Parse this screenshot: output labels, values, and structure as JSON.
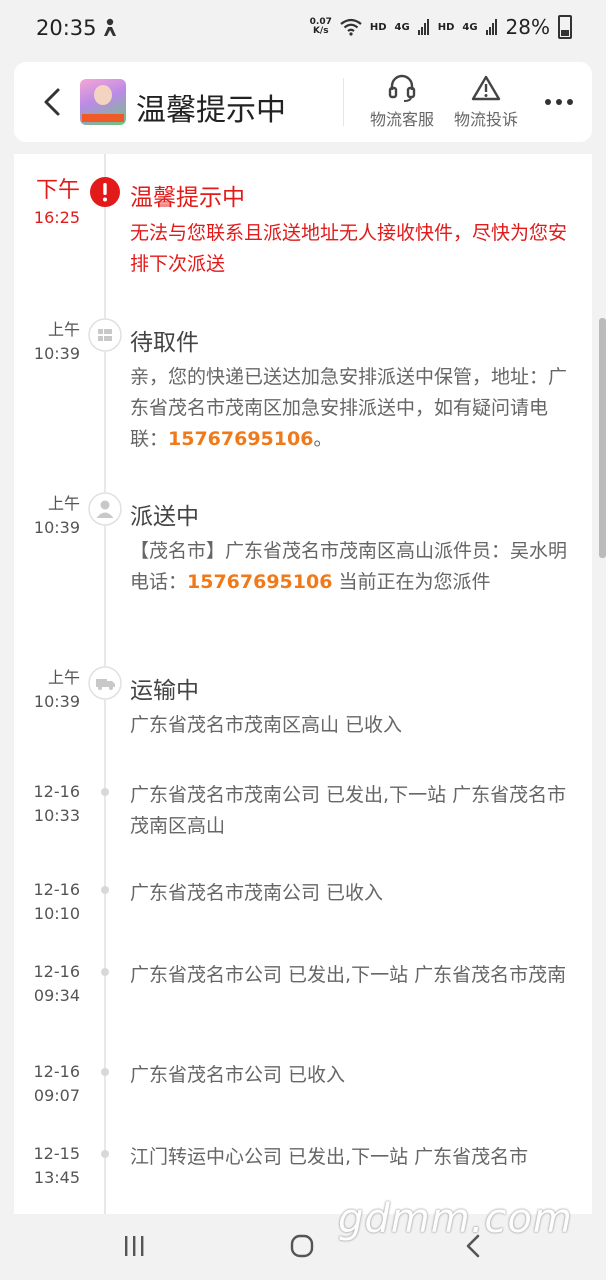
{
  "status_bar": {
    "time": "20:35",
    "speed_value": "0.07",
    "speed_unit": "K/s",
    "hd1": "HD",
    "net1": "4G",
    "hd2": "HD",
    "net2": "4G",
    "battery": "28%"
  },
  "header": {
    "title": "温馨提示中",
    "service_label": "物流客服",
    "complaint_label": "物流投诉",
    "icons": [
      "back-arrow-icon",
      "headset-icon",
      "warning-icon",
      "more-icon"
    ]
  },
  "timeline": [
    {
      "time1": "下午",
      "time2": "16:25",
      "title": "温馨提示中",
      "text": "无法与您联系且派送地址无人接收快件，尽快为您安排下次派送",
      "status": "alert"
    },
    {
      "time1": "上午",
      "time2": "10:39",
      "title": "待取件",
      "text_before": "亲，您的快递已送达加急安排派送中保管，地址：广东省茂名市茂南区加急安排派送中，如有疑问请电联：",
      "phone": "15767695106",
      "text_after": "。"
    },
    {
      "time1": "上午",
      "time2": "10:39",
      "title": "派送中",
      "text_before": "【茂名市】广东省茂名市茂南区高山派件员：吴水明 电话：",
      "phone": "15767695106",
      "text_after": " 当前正在为您派件"
    },
    {
      "time1": "上午",
      "time2": "10:39",
      "title": "运输中",
      "text": "广东省茂名市茂南区高山 已收入"
    },
    {
      "time1": "12-16",
      "time2": "10:33",
      "text": "广东省茂名市茂南公司 已发出,下一站 广东省茂名市茂南区高山"
    },
    {
      "time1": "12-16",
      "time2": "10:10",
      "text": "广东省茂名市茂南公司 已收入"
    },
    {
      "time1": "12-16",
      "time2": "09:34",
      "text": "广东省茂名市公司 已发出,下一站 广东省茂名市茂南"
    },
    {
      "time1": "12-16",
      "time2": "09:07",
      "text": "广东省茂名市公司 已收入"
    },
    {
      "time1": "12-15",
      "time2": "13:45",
      "text": "江门转运中心公司 已发出,下一站 广东省茂名市"
    }
  ],
  "watermark": "gdmm.com",
  "colors": {
    "alert": "#e21a1a",
    "phone": "#f07a1a"
  }
}
